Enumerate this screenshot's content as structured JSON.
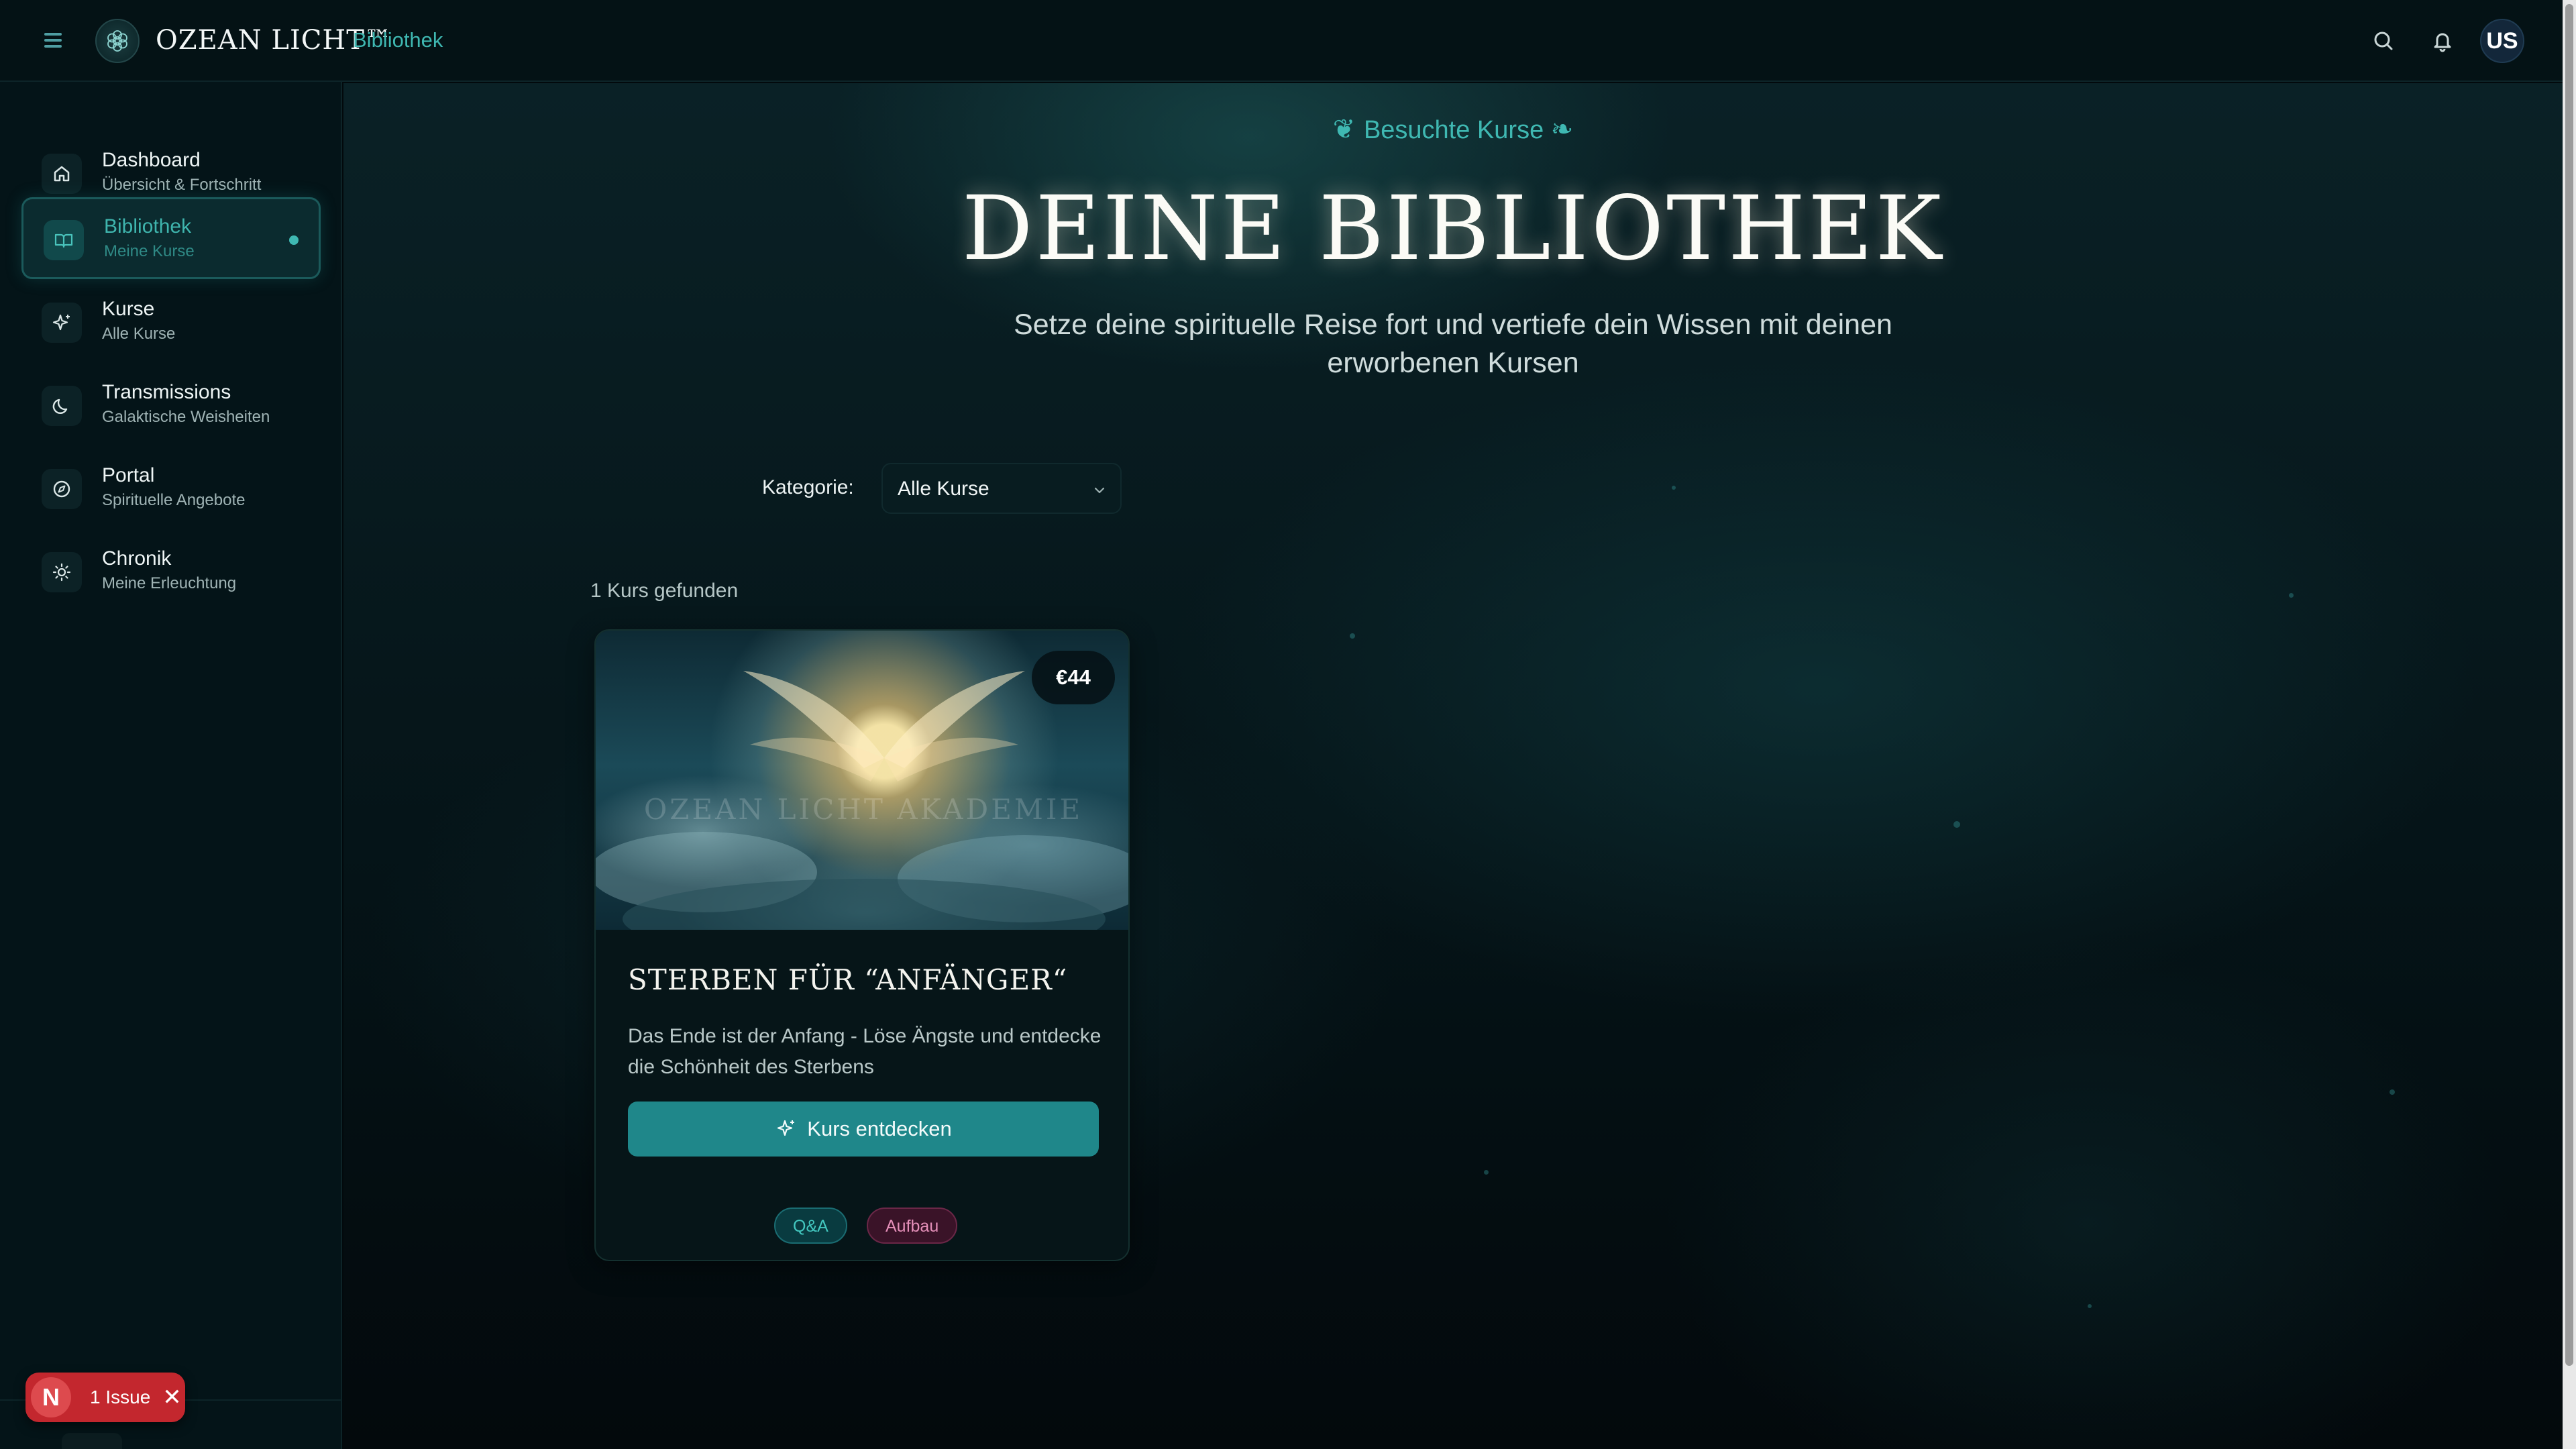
{
  "header": {
    "brand": "OZEAN LICHT™",
    "section": "Bibliothek",
    "avatar_initials": "US",
    "icons": [
      "menu-icon",
      "search-icon",
      "bell-icon"
    ]
  },
  "sidebar": {
    "items": [
      {
        "label": "Dashboard",
        "sublabel": "Übersicht & Fortschritt",
        "icon": "home-icon"
      },
      {
        "label": "Bibliothek",
        "sublabel": "Meine Kurse",
        "icon": "book-icon",
        "active": true
      },
      {
        "label": "Kurse",
        "sublabel": "Alle Kurse",
        "icon": "sparkles-icon"
      },
      {
        "label": "Transmissions",
        "sublabel": "Galaktische Weisheiten",
        "icon": "moon-icon"
      },
      {
        "label": "Portal",
        "sublabel": "Spirituelle Angebote",
        "icon": "compass-icon"
      },
      {
        "label": "Chronik",
        "sublabel": "Meine Erleuchtung",
        "icon": "sun-icon"
      }
    ]
  },
  "issue_badge": {
    "letter": "N",
    "label": "1 Issue"
  },
  "main": {
    "eyebrow": "Besuchte Kurse",
    "title": "DEINE BIBLIOTHEK",
    "subtitle": "Setze deine spirituelle Reise fort und vertiefe dein Wissen mit deinen erworbenen Kursen",
    "filter": {
      "label": "Kategorie:",
      "value": "Alle Kurse"
    },
    "result_count": "1 Kurs gefunden",
    "courses": [
      {
        "title": "STERBEN FÜR “ANFÄNGER“",
        "description": "Das Ende ist der Anfang - Löse Ängste und entdecke die Schönheit des Sterbens",
        "price": "€44",
        "watermark": "OZEAN LICHT AKADEMIE",
        "button_label": "Kurs entdecken",
        "tags": [
          "Q&A",
          "Aufbau"
        ]
      }
    ]
  },
  "colors": {
    "accent": "#3fb8b2",
    "button": "#1f878a",
    "issue_red": "#c3272e",
    "tag_qa": "#43c8c0",
    "tag_aufbau": "#e58fb9"
  }
}
